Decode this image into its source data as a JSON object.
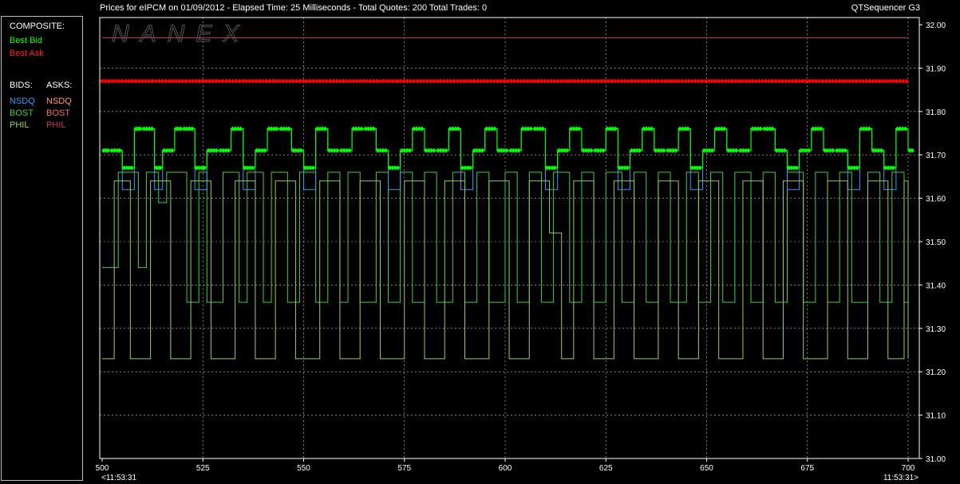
{
  "window": {
    "title": "Prices for  eIPCM  on  01/09/2012  -  Elapsed Time: 25 Milliseconds  -  Total Quotes: 200  Total Trades: 0",
    "app_name": "QTSequencer G3",
    "watermark": "NANEX"
  },
  "legend": {
    "composite_heading": "COMPOSITE:",
    "best_bid": "Best Bid",
    "best_ask": "Best Ask",
    "bids_heading": "BIDS:",
    "asks_heading": "ASKS:",
    "bids": [
      "NSDQ",
      "BOST",
      "PHIL"
    ],
    "asks": [
      "NSDQ",
      "BOST",
      "PHIL"
    ]
  },
  "colors": {
    "best_bid": "#00ff00",
    "best_ask": "#ff0000",
    "nsdq_bid": "#3399ff",
    "bost_bid": "#44cc44",
    "phil_bid": "#99cc66",
    "nsdq_ask": "#ff9966",
    "bost_ask": "#ff6666",
    "phil_ask": "#cc3366",
    "grid": "#ffffff",
    "axis": "#ffffff"
  },
  "chart_data": {
    "type": "line",
    "title": "",
    "xlabel": "",
    "ylabel": "",
    "xlim": [
      500,
      700
    ],
    "ylim": [
      31.0,
      32.0
    ],
    "x_ticks": [
      500,
      525,
      550,
      575,
      600,
      625,
      650,
      675,
      700
    ],
    "x_tick_labels": [
      "500",
      "525",
      "550",
      "575",
      "600",
      "625",
      "650",
      "675",
      "700"
    ],
    "y_ticks": [
      31.0,
      31.1,
      31.2,
      31.3,
      31.4,
      31.5,
      31.6,
      31.7,
      31.8,
      31.9,
      32.0
    ],
    "y_tick_labels": [
      "31.00",
      "31.10",
      "31.20",
      "31.30",
      "31.40",
      "31.50",
      "31.60",
      "31.70",
      "31.80",
      "31.90",
      "32.00"
    ],
    "start_time_label": "<11:53:31",
    "end_time_label": "11:53:31>",
    "grid": true,
    "legend_position": "left-panel",
    "series": [
      {
        "name": "PHIL",
        "side": "ask",
        "step": true,
        "x": [
          500,
          700
        ],
        "values": [
          31.97,
          31.97
        ]
      },
      {
        "name": "Best Ask",
        "side": "ask",
        "step": true,
        "markers": true,
        "x": [
          500,
          700
        ],
        "values": [
          31.87,
          31.87
        ]
      },
      {
        "name": "Best Bid",
        "side": "bid",
        "step": true,
        "markers": true,
        "x": [
          500,
          502,
          505,
          508,
          510,
          513,
          515,
          518,
          520,
          523,
          526,
          529,
          532,
          535,
          538,
          541,
          544,
          547,
          550,
          553,
          556,
          559,
          562,
          565,
          568,
          571,
          574,
          577,
          580,
          583,
          586,
          589,
          592,
          595,
          598,
          601,
          604,
          607,
          610,
          613,
          616,
          619,
          622,
          625,
          628,
          631,
          634,
          637,
          640,
          643,
          646,
          649,
          652,
          655,
          658,
          661,
          664,
          667,
          670,
          673,
          676,
          679,
          682,
          685,
          688,
          691,
          694,
          697,
          700
        ],
        "values": [
          31.71,
          31.71,
          31.67,
          31.76,
          31.76,
          31.67,
          31.71,
          31.76,
          31.76,
          31.67,
          31.71,
          31.71,
          31.76,
          31.67,
          31.71,
          31.76,
          31.76,
          31.71,
          31.67,
          31.76,
          31.71,
          31.71,
          31.76,
          31.76,
          31.71,
          31.67,
          31.71,
          31.76,
          31.71,
          31.71,
          31.76,
          31.67,
          31.71,
          31.76,
          31.71,
          31.71,
          31.76,
          31.76,
          31.67,
          31.71,
          31.76,
          31.71,
          31.71,
          31.76,
          31.67,
          31.71,
          31.76,
          31.71,
          31.71,
          31.76,
          31.67,
          31.71,
          31.76,
          31.71,
          31.71,
          31.76,
          31.76,
          31.71,
          31.67,
          31.71,
          31.76,
          31.71,
          31.71,
          31.67,
          31.76,
          31.71,
          31.67,
          31.76,
          31.71
        ]
      },
      {
        "name": "NSDQ",
        "side": "bid",
        "step": true,
        "x": [
          500,
          502,
          505,
          508,
          510,
          513,
          515,
          518,
          520,
          523,
          526,
          529,
          532,
          535,
          538,
          541,
          544,
          547,
          550,
          553,
          556,
          559,
          562,
          565,
          568,
          571,
          574,
          577,
          580,
          583,
          586,
          589,
          592,
          595,
          598,
          601,
          604,
          607,
          610,
          613,
          616,
          619,
          622,
          625,
          628,
          631,
          634,
          637,
          640,
          643,
          646,
          649,
          652,
          655,
          658,
          661,
          664,
          667,
          670,
          673,
          676,
          679,
          682,
          685,
          688,
          691,
          694,
          697,
          700
        ],
        "values": [
          31.71,
          31.71,
          31.62,
          31.76,
          31.76,
          31.62,
          31.71,
          31.76,
          31.76,
          31.62,
          31.71,
          31.71,
          31.76,
          31.62,
          31.71,
          31.76,
          31.76,
          31.71,
          31.62,
          31.76,
          31.71,
          31.71,
          31.76,
          31.76,
          31.71,
          31.62,
          31.71,
          31.76,
          31.71,
          31.71,
          31.76,
          31.62,
          31.71,
          31.76,
          31.71,
          31.71,
          31.76,
          31.76,
          31.62,
          31.71,
          31.76,
          31.71,
          31.71,
          31.76,
          31.62,
          31.71,
          31.76,
          31.71,
          31.71,
          31.76,
          31.62,
          31.71,
          31.76,
          31.71,
          31.71,
          31.76,
          31.76,
          31.71,
          31.62,
          31.71,
          31.76,
          31.71,
          31.71,
          31.62,
          31.76,
          31.71,
          31.62,
          31.76,
          31.71
        ]
      },
      {
        "name": "BOST",
        "side": "bid",
        "step": true,
        "x": [
          500,
          504,
          509,
          511,
          514,
          516,
          521,
          524,
          526,
          530,
          534,
          536,
          540,
          542,
          546,
          549,
          553,
          556,
          559,
          561,
          564,
          568,
          571,
          574,
          577,
          580,
          583,
          587,
          590,
          593,
          596,
          600,
          603,
          606,
          609,
          612,
          616,
          619,
          622,
          625,
          629,
          632,
          635,
          638,
          641,
          645,
          648,
          651,
          654,
          657,
          661,
          664,
          667,
          670,
          674,
          677,
          680,
          683,
          686,
          690,
          693,
          696,
          699,
          700
        ],
        "values": [
          31.44,
          31.66,
          31.44,
          31.66,
          31.59,
          31.66,
          31.36,
          31.66,
          31.36,
          31.66,
          31.36,
          31.66,
          31.36,
          31.66,
          31.36,
          31.66,
          31.36,
          31.66,
          31.36,
          31.66,
          31.36,
          31.66,
          31.36,
          31.66,
          31.36,
          31.66,
          31.36,
          31.66,
          31.36,
          31.66,
          31.36,
          31.66,
          31.36,
          31.66,
          31.36,
          31.66,
          31.36,
          31.66,
          31.36,
          31.66,
          31.36,
          31.66,
          31.36,
          31.66,
          31.36,
          31.66,
          31.36,
          31.66,
          31.36,
          31.66,
          31.36,
          31.66,
          31.36,
          31.66,
          31.36,
          31.66,
          31.36,
          31.66,
          31.36,
          31.66,
          31.36,
          31.66,
          31.36,
          31.36
        ]
      },
      {
        "name": "PHIL",
        "side": "bid",
        "step": true,
        "x": [
          500,
          503,
          507,
          512,
          517,
          522,
          527,
          533,
          538,
          543,
          548,
          554,
          559,
          564,
          569,
          575,
          580,
          585,
          590,
          596,
          601,
          606,
          611,
          614,
          617,
          622,
          627,
          632,
          638,
          643,
          648,
          653,
          659,
          664,
          669,
          674,
          680,
          685,
          690,
          695,
          699,
          700
        ],
        "values": [
          31.23,
          31.64,
          31.23,
          31.64,
          31.23,
          31.64,
          31.23,
          31.64,
          31.23,
          31.64,
          31.23,
          31.64,
          31.23,
          31.64,
          31.23,
          31.64,
          31.23,
          31.64,
          31.23,
          31.64,
          31.23,
          31.64,
          31.52,
          31.23,
          31.64,
          31.23,
          31.64,
          31.23,
          31.64,
          31.23,
          31.64,
          31.23,
          31.64,
          31.23,
          31.64,
          31.23,
          31.64,
          31.23,
          31.64,
          31.23,
          31.64,
          31.23
        ]
      }
    ]
  }
}
